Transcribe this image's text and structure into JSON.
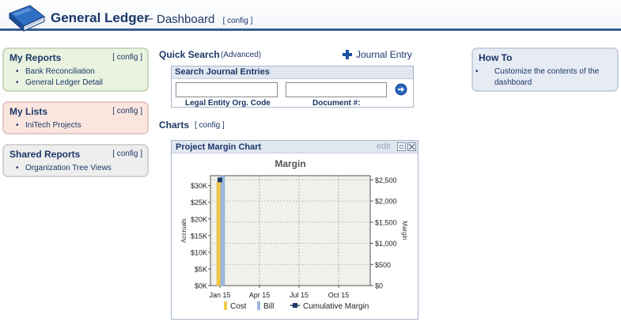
{
  "header": {
    "title": "General Ledger",
    "separator": "–",
    "subtitle": "Dashboard",
    "config": "[ config ]"
  },
  "panels": {
    "my_reports": {
      "title": "My Reports",
      "config": "[ config ]",
      "items": [
        "Bank Reconciliation",
        "General Ledger Detail"
      ]
    },
    "my_lists": {
      "title": "My Lists",
      "config": "[ config ]",
      "items": [
        "IniTech Projects"
      ]
    },
    "shared_reports": {
      "title": "Shared Reports",
      "config": "[ config ]",
      "items": [
        "Organization Tree Views"
      ]
    },
    "how_to": {
      "title": "How To",
      "items": [
        "Customize the contents of the dashboard"
      ]
    }
  },
  "quick_search": {
    "title": "Quick Search",
    "advanced": "(Advanced)",
    "journal_entry": "Journal Entry",
    "box_title": "Search Journal Entries",
    "field1_label": "Legal Entity Org. Code",
    "field1_value": "",
    "field2_label": "Document #:",
    "field2_value": ""
  },
  "charts": {
    "title": "Charts",
    "config": "[ config ]",
    "window_title": "Project Margin Chart",
    "edit": "edit"
  },
  "colors": {
    "brand": "#1c3766",
    "header_rule": "#3a5c94",
    "cost": "#f2c94c",
    "bill": "#9fb8dc",
    "margin": "#1f3a6b"
  },
  "chart_data": {
    "type": "bar",
    "title": "Margin",
    "ylabel": "Accruals",
    "y2label": "Margin",
    "categories": [
      "Jan 15",
      "Apr 15",
      "Jul 15",
      "Oct 15"
    ],
    "x_ticks": [
      "Jan 15",
      "Apr 15",
      "Jul 15",
      "Oct 15"
    ],
    "y_ticks": [
      "$0K",
      "$5K",
      "$10K",
      "$15K",
      "$20K",
      "$25K",
      "$30K"
    ],
    "y2_ticks": [
      "$0",
      "$500",
      "$1,000",
      "$1,500",
      "$2,000",
      "$2,500"
    ],
    "ylim": [
      0,
      33000
    ],
    "y2lim": [
      0,
      2600
    ],
    "series": [
      {
        "name": "Cost",
        "kind": "bar",
        "axis": "left",
        "values": [
          31000,
          null,
          null,
          null
        ]
      },
      {
        "name": "Bill",
        "kind": "bar",
        "axis": "left",
        "values": [
          33000,
          null,
          null,
          null
        ]
      },
      {
        "name": "Cumulative Margin",
        "kind": "point",
        "axis": "right",
        "values": [
          2500,
          null,
          null,
          null
        ]
      }
    ],
    "grid": true,
    "legend": "bottom"
  }
}
